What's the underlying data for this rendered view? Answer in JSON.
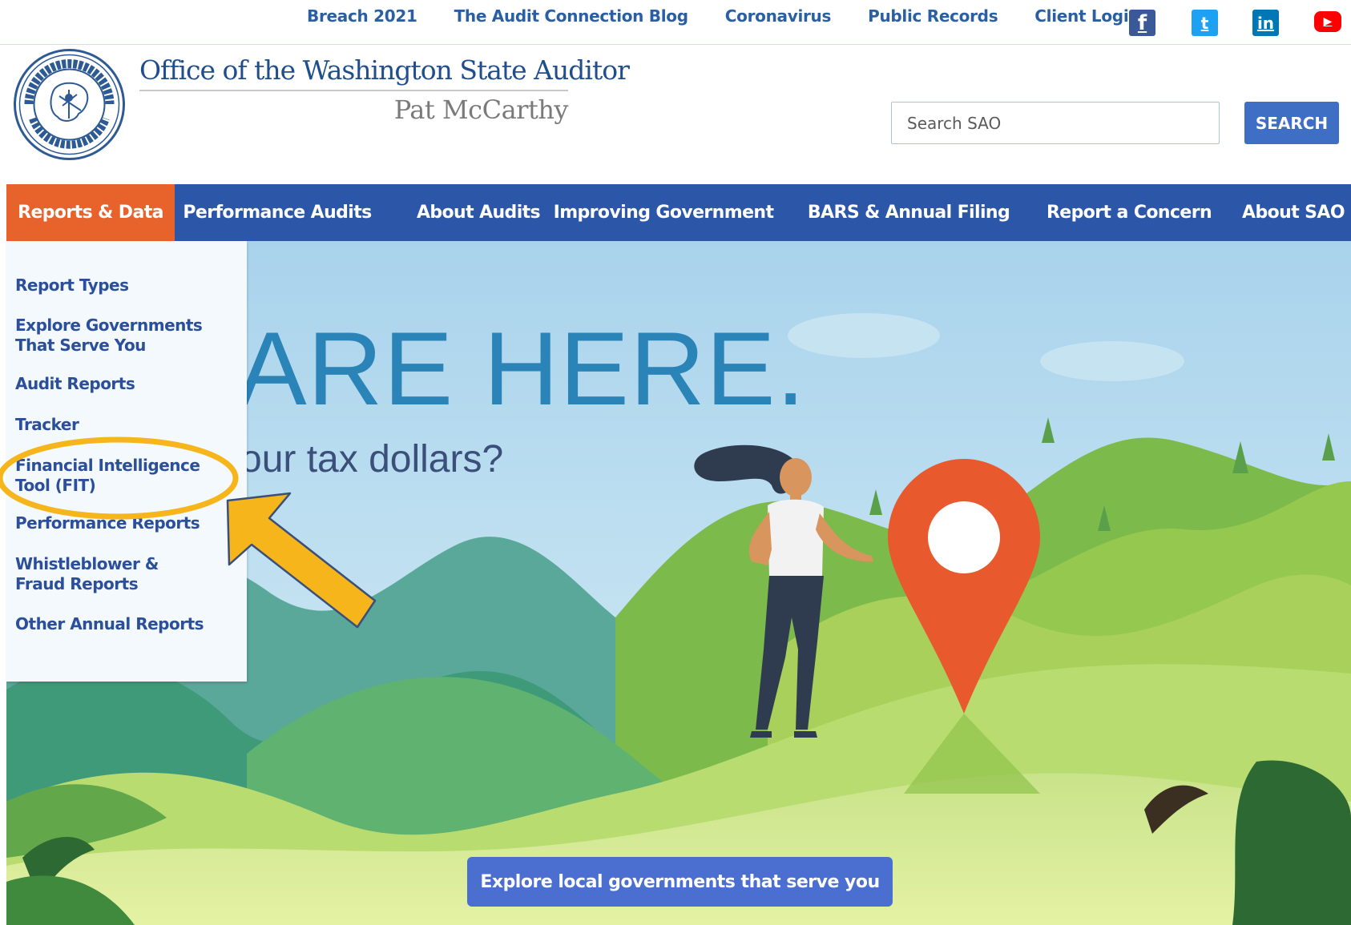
{
  "utility_nav": {
    "links": [
      "Breach 2021",
      "The Audit Connection Blog",
      "Coronavirus",
      "Public Records",
      "Client Login"
    ]
  },
  "social": {
    "facebook": "f",
    "twitter": "t",
    "linkedin": "in",
    "youtube": "▶"
  },
  "brand": {
    "title": "Office of the Washington State Auditor",
    "subtitle": "Pat McCarthy",
    "seal_icon": "state-auditor-seal-icon"
  },
  "search": {
    "placeholder": "Search SAO",
    "button_label": "SEARCH"
  },
  "main_nav": {
    "items": [
      "Reports & Data",
      "Performance Audits",
      "About Audits",
      "Improving Government",
      "BARS & Annual Filing",
      "Report a Concern",
      "About SAO"
    ],
    "active_index": 0
  },
  "dropdown": {
    "items": [
      "Report Types",
      "Explore Governments That Serve You",
      "Audit Reports",
      "Tracker",
      "Financial Intelligence Tool (FIT)",
      "Performance Reports",
      "Whistleblower & Fraud Reports",
      "Other Annual Reports"
    ],
    "highlighted_index": 4
  },
  "hero": {
    "headline": "ARE HERE.",
    "subheadline": "our tax dollars?",
    "cta_label": "Explore local governments that serve you"
  },
  "colors": {
    "nav_background": "#2c56a7",
    "nav_active": "#e8622b",
    "link_blue": "#2b5fa3",
    "annotation_yellow": "#f5b51b",
    "pin_orange": "#e8592d"
  }
}
